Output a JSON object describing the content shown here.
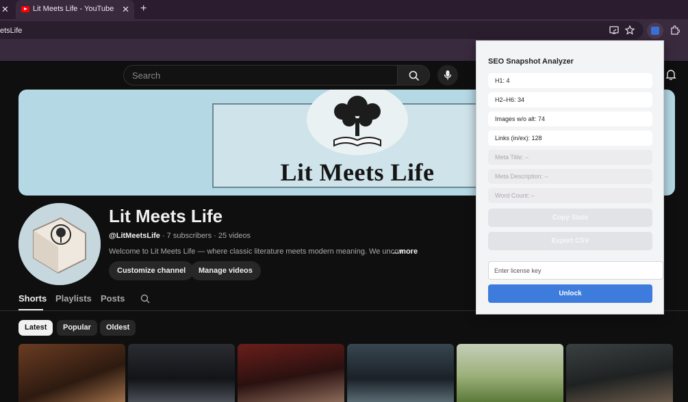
{
  "browser": {
    "tab_title": "Lit Meets Life - YouTube",
    "url_fragment": "etsLife",
    "icons": [
      "close-icon",
      "youtube-favicon",
      "plus-icon",
      "cast-icon",
      "star-icon",
      "extension-icon",
      "puzzle-icon"
    ]
  },
  "youtube": {
    "search_placeholder": "Search",
    "banner_text": "Lit Meets Life",
    "channel": {
      "name": "Lit Meets Life",
      "handle": "@LitMeetsLife",
      "meta_rest": " · 7 subscribers · 25 videos",
      "description": "Welcome to Lit Meets Life — where classic literature meets modern meaning. We uncov",
      "more_label": "...more"
    },
    "buttons": {
      "customize": "Customize channel",
      "manage": "Manage videos"
    },
    "tabs": [
      {
        "label": "Shorts"
      },
      {
        "label": "Playlists"
      },
      {
        "label": "Posts"
      }
    ],
    "chips": [
      {
        "label": "Latest"
      },
      {
        "label": "Popular"
      },
      {
        "label": "Oldest"
      }
    ],
    "colors": {
      "brand": "#ff0000",
      "background": "#0f0f0f"
    }
  },
  "popup": {
    "title": "SEO Snapshot Analyzer",
    "stats": [
      {
        "label": "H1: 4"
      },
      {
        "label": "H2–H6: 34"
      },
      {
        "label": "Images w/o alt: 74"
      },
      {
        "label": "Links (in/ex): 128"
      },
      {
        "label": "Meta Title: –"
      },
      {
        "label": "Meta Description: –"
      },
      {
        "label": "Word Count: –"
      }
    ],
    "copy_label": "Copy Stats",
    "export_label": "Export CSV",
    "license_placeholder": "Enter license key",
    "unlock_label": "Unlock",
    "colors": {
      "accent": "#3d7bdc"
    }
  }
}
